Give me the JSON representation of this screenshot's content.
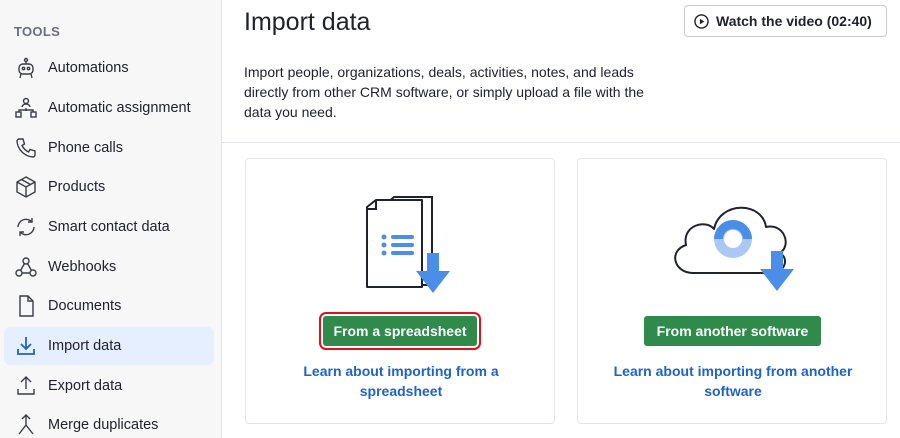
{
  "sidebar": {
    "heading": "TOOLS",
    "items": [
      {
        "label": "Automations",
        "icon": "robot-icon"
      },
      {
        "label": "Automatic assignment",
        "icon": "assignment-icon"
      },
      {
        "label": "Phone calls",
        "icon": "phone-icon"
      },
      {
        "label": "Products",
        "icon": "box-icon"
      },
      {
        "label": "Smart contact data",
        "icon": "sync-icon"
      },
      {
        "label": "Webhooks",
        "icon": "webhook-icon"
      },
      {
        "label": "Documents",
        "icon": "document-icon"
      },
      {
        "label": "Import data",
        "icon": "download-icon",
        "active": true
      },
      {
        "label": "Export data",
        "icon": "upload-icon"
      },
      {
        "label": "Merge duplicates",
        "icon": "merge-icon"
      }
    ]
  },
  "main": {
    "title": "Import data",
    "video_button": "Watch the video (02:40)",
    "intro": "Import people, organizations, deals, activities, notes, and leads directly from other CRM software, or simply upload a file with the data you need.",
    "cards": [
      {
        "button": "From a spreadsheet",
        "link": "Learn about importing from a spreadsheet",
        "illustration": "spreadsheet-download-icon"
      },
      {
        "button": "From another software",
        "link": "Learn about importing from another software",
        "illustration": "cloud-download-icon"
      }
    ]
  },
  "colors": {
    "accent_blue": "#4a8ee8",
    "light_blue": "#a9c8f3",
    "button_green": "#2f8a4c",
    "link_blue": "#1e63c7",
    "active_bg": "#e6efff",
    "highlight_red": "#e0101c"
  }
}
